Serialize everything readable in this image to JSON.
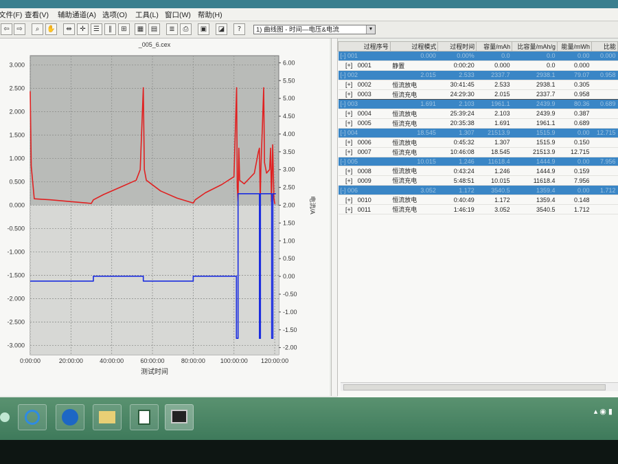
{
  "app": {
    "title_text": "",
    "menu": [
      "文件(F)",
      "查看(V)",
      "辅助通道(A)",
      "选项(O)",
      "工具(L)",
      "窗口(W)",
      "帮助(H)"
    ],
    "view_selector": "1) 曲线图 - 时间—电压&电流",
    "toolbar_icons": [
      "arrow-left-icon",
      "arrow-right-icon",
      "zoom-select-icon",
      "hand-icon",
      "h-cursor-icon",
      "cross-cursor-icon",
      "split-h-icon",
      "split-v-icon",
      "grid-icon",
      "table-icon",
      "report-icon",
      "list-icon",
      "print-icon",
      "layout-icon",
      "export-icon",
      "help-icon"
    ]
  },
  "chart_data": {
    "type": "line",
    "title": "_005_6.cex",
    "xlabel": "测试时间",
    "y2label": "电流/A",
    "x_ticks": [
      "0:00:00",
      "20:00:00",
      "40:00:00",
      "60:00:00",
      "80:00:00",
      "100:00:00",
      "120:00:00"
    ],
    "y_left_ticks": [
      "3.000",
      "2.500",
      "2.000",
      "1.500",
      "1.000",
      "0.500",
      "0.000",
      "-0.500",
      "-1.000",
      "-1.500",
      "-2.000",
      "-2.500",
      "-3.000"
    ],
    "y_right_ticks": [
      "6.00",
      "5.50",
      "5.00",
      "4.50",
      "4.00",
      "3.50",
      "3.00",
      "2.50",
      "2.00",
      "1.50",
      "1.00",
      "0.50",
      "0.00",
      "-0.50",
      "-1.00",
      "-1.50",
      "-2.00"
    ],
    "ylim_left": [
      -3.2,
      3.2
    ],
    "ylim_right": [
      -2.2,
      6.2
    ],
    "xlim_hours": [
      0,
      122
    ],
    "series": [
      {
        "color": "#e02020",
        "axis": "right",
        "points": [
          [
            0,
            5.2
          ],
          [
            0.5,
            3.1
          ],
          [
            2,
            2.18
          ],
          [
            10,
            2.15
          ],
          [
            20,
            2.1
          ],
          [
            30,
            2.05
          ],
          [
            31,
            2.15
          ],
          [
            36,
            2.3
          ],
          [
            44,
            2.5
          ],
          [
            52,
            2.7
          ],
          [
            54,
            3.0
          ],
          [
            55.5,
            5.3
          ],
          [
            56,
            3.0
          ],
          [
            57,
            2.7
          ],
          [
            64,
            2.4
          ],
          [
            72,
            2.2
          ],
          [
            80,
            2.06
          ],
          [
            81,
            2.15
          ],
          [
            86,
            2.35
          ],
          [
            94,
            2.58
          ],
          [
            100,
            2.8
          ],
          [
            101.3,
            5.3
          ],
          [
            101.6,
            2.5
          ],
          [
            102,
            2.1
          ],
          [
            102.4,
            3.6
          ],
          [
            102.8,
            2.7
          ],
          [
            105,
            2.6
          ],
          [
            110,
            2.9
          ],
          [
            112,
            3.5
          ],
          [
            112.5,
            3.6
          ],
          [
            112.9,
            2.1
          ],
          [
            113.2,
            3.0
          ],
          [
            114,
            4.3
          ],
          [
            114.6,
            5.3
          ],
          [
            115,
            3.2
          ],
          [
            116,
            2.9
          ],
          [
            117.5,
            3.0
          ],
          [
            118,
            3.6
          ],
          [
            118.4,
            2.1
          ],
          [
            119,
            3.7
          ],
          [
            119.6,
            2.2
          ],
          [
            120,
            2.05
          ],
          [
            120.3,
            2.05
          ]
        ]
      },
      {
        "color": "#1a2ce0",
        "axis": "left",
        "points": [
          [
            0,
            -1.625
          ],
          [
            31,
            -1.625
          ],
          [
            31,
            -1.52
          ],
          [
            55.5,
            -1.52
          ],
          [
            55.5,
            -1.625
          ],
          [
            80,
            -1.625
          ],
          [
            80,
            -1.52
          ],
          [
            101.2,
            -1.52
          ],
          [
            101.2,
            -2.85
          ],
          [
            102,
            -2.85
          ],
          [
            102,
            0.245
          ],
          [
            112.5,
            0.245
          ],
          [
            112.5,
            -2.85
          ],
          [
            113,
            -2.85
          ],
          [
            113,
            0.245
          ],
          [
            118.5,
            0.245
          ],
          [
            118.5,
            -2.85
          ],
          [
            119.1,
            -2.85
          ],
          [
            119.1,
            0.245
          ],
          [
            120.6,
            0.245
          ]
        ]
      }
    ]
  },
  "grid": {
    "columns": [
      "过程序号",
      "过程模式",
      "过程时间",
      "容量/mAh",
      "比容量/mAh/g",
      "能量/mWh",
      "比能"
    ],
    "rows": [
      {
        "kind": "step",
        "toggle": "[-]",
        "no": "001",
        "mode": "0.000",
        "time": "0.00%",
        "cap": "0.0",
        "scap": "0.0",
        "energy": "0.00",
        "extra": "0.000"
      },
      {
        "kind": "sub",
        "toggle": "[+]",
        "no": "0001",
        "mode": "静置",
        "time": "0:00:20",
        "cap": "0.000",
        "scap": "0.0",
        "energy": "0.000"
      },
      {
        "kind": "step",
        "toggle": "[-]",
        "no": "002",
        "mode": "2.015",
        "time": "2.533",
        "cap": "2337.7",
        "scap": "2938.1",
        "energy": "79.07",
        "extra": "0.958"
      },
      {
        "kind": "sub",
        "toggle": "[+]",
        "no": "0002",
        "mode": "恒流放电",
        "time": "30:41:45",
        "cap": "2.533",
        "scap": "2938.1",
        "energy": "0.305"
      },
      {
        "kind": "sub",
        "toggle": "[+]",
        "no": "0003",
        "mode": "恒流充电",
        "time": "24:29:30",
        "cap": "2.015",
        "scap": "2337.7",
        "energy": "0.958",
        "selected": true
      },
      {
        "kind": "step",
        "toggle": "[-]",
        "no": "003",
        "mode": "1.691",
        "time": "2.103",
        "cap": "1961.1",
        "scap": "2439.9",
        "energy": "80.36",
        "extra": "0.689"
      },
      {
        "kind": "sub",
        "toggle": "[+]",
        "no": "0004",
        "mode": "恒流放电",
        "time": "25:39:24",
        "cap": "2.103",
        "scap": "2439.9",
        "energy": "0.387"
      },
      {
        "kind": "sub",
        "toggle": "[+]",
        "no": "0005",
        "mode": "恒流充电",
        "time": "20:35:38",
        "cap": "1.691",
        "scap": "1961.1",
        "energy": "0.689"
      },
      {
        "kind": "step",
        "toggle": "[-]",
        "no": "004",
        "mode": "18.545",
        "time": "1.307",
        "cap": "21513.9",
        "scap": "1515.9",
        "energy": "0.00",
        "extra": "12.715"
      },
      {
        "kind": "sub",
        "toggle": "[+]",
        "no": "0006",
        "mode": "恒流放电",
        "time": "0:45:32",
        "cap": "1.307",
        "scap": "1515.9",
        "energy": "0.150"
      },
      {
        "kind": "sub",
        "toggle": "[+]",
        "no": "0007",
        "mode": "恒流充电",
        "time": "10:46:08",
        "cap": "18.545",
        "scap": "21513.9",
        "energy": "12.715"
      },
      {
        "kind": "step",
        "toggle": "[-]",
        "no": "005",
        "mode": "10.015",
        "time": "1.246",
        "cap": "11618.4",
        "scap": "1444.9",
        "energy": "0.00",
        "extra": "7.956"
      },
      {
        "kind": "sub",
        "toggle": "[+]",
        "no": "0008",
        "mode": "恒流放电",
        "time": "0:43:24",
        "cap": "1.246",
        "scap": "1444.9",
        "energy": "0.159"
      },
      {
        "kind": "sub",
        "toggle": "[+]",
        "no": "0009",
        "mode": "恒流充电",
        "time": "5:48:51",
        "cap": "10.015",
        "scap": "11618.4",
        "energy": "7.956"
      },
      {
        "kind": "step",
        "toggle": "[-]",
        "no": "006",
        "mode": "3.052",
        "time": "1.172",
        "cap": "3540.5",
        "scap": "1359.4",
        "energy": "0.00",
        "extra": "1.712"
      },
      {
        "kind": "sub",
        "toggle": "[+]",
        "no": "0010",
        "mode": "恒流放电",
        "time": "0:40:49",
        "cap": "1.172",
        "scap": "1359.4",
        "energy": "0.148"
      },
      {
        "kind": "sub",
        "toggle": "[+]",
        "no": "0011",
        "mode": "恒流充电",
        "time": "1:46:19",
        "cap": "3.052",
        "scap": "3540.5",
        "energy": "1.712"
      }
    ]
  },
  "taskbar": {
    "apps": [
      "ie-icon",
      "teamviewer-icon",
      "file-explorer-icon",
      "battery-test-app-icon",
      "chart-app-icon"
    ]
  }
}
